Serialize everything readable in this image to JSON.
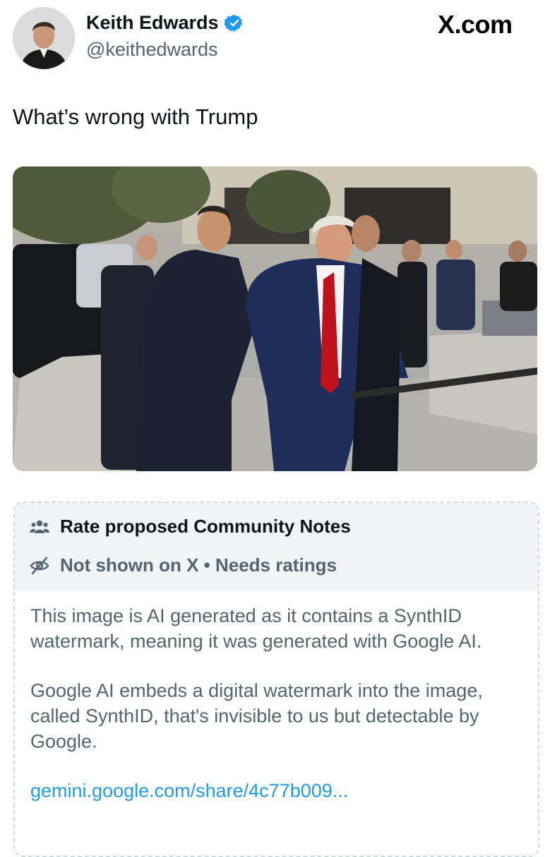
{
  "author": {
    "name": "Keith Edwards",
    "handle": "@keithedwards",
    "verified": true
  },
  "brand": "X.com",
  "tweet": {
    "text": "What’s wrong with Trump"
  },
  "community_note": {
    "title": "Rate proposed Community Notes",
    "status": "Not shown on X • Needs ratings",
    "paragraphs": [
      "This image is AI generated as it contains a SynthID watermark, meaning it was generated with Google AI.",
      "Google AI embeds a digital watermark into the image, called SynthID, that's invisible to us but detectable by Google."
    ],
    "link": "gemini.google.com/share/4c77b009..."
  },
  "colors": {
    "verified_badge": "#1d9bf0",
    "link": "#1d9bf0",
    "secondary_text": "#536471",
    "note_header_bg": "#f1f4f6"
  },
  "icons": {
    "verified": "verified-badge-icon",
    "people": "people-icon",
    "hidden": "eye-off-icon"
  }
}
